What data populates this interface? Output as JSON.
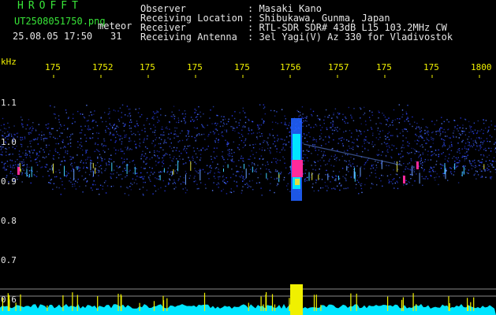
{
  "brand": "HROFFT",
  "file": {
    "name": "UT2508051750.png",
    "mode": "meteor"
  },
  "timestamp": {
    "datetime": "25.08.05 17:50",
    "count": "31"
  },
  "info": [
    {
      "label": "Observer",
      "value": ": Masaki Kano"
    },
    {
      "label": "Receiving Location",
      "value": ": Shibukawa, Gunma, Japan"
    },
    {
      "label": "Receiver",
      "value": ": RTL-SDR SDR# 43dB L15 103.2MHz CW"
    },
    {
      "label": "Receiving Antenna",
      "value": ": 3el Yagi(V) Az 330 for Vladivostok"
    }
  ],
  "axis": {
    "unit": "kHz",
    "y_labels": [
      "1.1",
      "1.0",
      "0.9",
      "0.8",
      "0.7",
      "0.6"
    ],
    "y_range_khz": [
      0.58,
      1.17
    ],
    "x_labels": [
      "175",
      "1752",
      "175",
      "175",
      "175",
      "1756",
      "1757",
      "175",
      "175",
      "1800"
    ]
  },
  "colors": {
    "text_green": "#38e638",
    "text_white": "#e6e6e6",
    "axis_yellow": "#f0f000",
    "noise_blue": "#2a3cff",
    "spectrum_cyan": "#00e5ff",
    "meteor_magenta": "#ff2a9a"
  }
}
